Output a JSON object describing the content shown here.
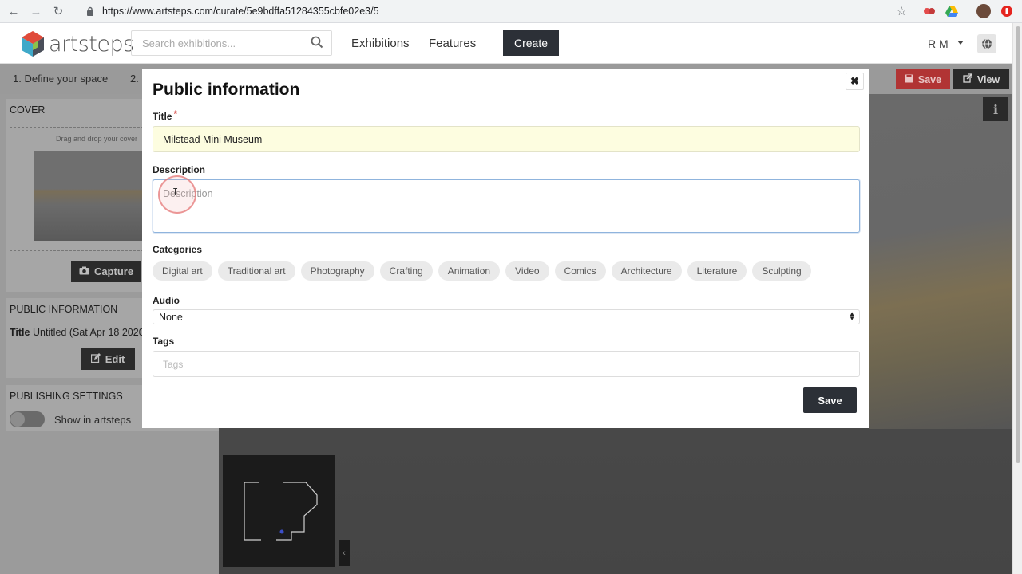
{
  "browser": {
    "url": "https://www.artsteps.com/curate/5e9bdffa51284355cbfe02e3/5"
  },
  "app": {
    "logo_text": "artsteps",
    "search_placeholder": "Search exhibitions...",
    "nav": {
      "exhibitions": "Exhibitions",
      "features": "Features",
      "create": "Create"
    },
    "user": "R M"
  },
  "editor": {
    "steps": [
      "1. Define your space",
      "2."
    ],
    "save_label": "Save",
    "view_label": "View",
    "cover": {
      "heading": "COVER",
      "drop_text": "Drag and drop your cover",
      "capture_label": "Capture"
    },
    "public_info": {
      "heading": "PUBLIC INFORMATION",
      "title_key": "Title",
      "title_value": "Untitled (Sat Apr 18 2020",
      "edit_label": "Edit"
    },
    "publishing": {
      "heading": "PUBLISHING SETTINGS",
      "toggle_label": "Show in artsteps"
    }
  },
  "modal": {
    "title": "Public information",
    "close_symbol": "✖",
    "title_label": "Title",
    "required_mark": "*",
    "title_value": "Milstead Mini Museum",
    "description_label": "Description",
    "description_placeholder": "Description",
    "categories_label": "Categories",
    "categories": [
      "Digital art",
      "Traditional art",
      "Photography",
      "Crafting",
      "Animation",
      "Video",
      "Comics",
      "Architecture",
      "Literature",
      "Sculpting"
    ],
    "audio_label": "Audio",
    "audio_value": "None",
    "tags_label": "Tags",
    "tags_placeholder": "Tags",
    "save_label": "Save"
  },
  "colors": {
    "primary_dark": "#2c3037",
    "danger": "#b13434",
    "title_field_bg": "#fdfde0"
  }
}
